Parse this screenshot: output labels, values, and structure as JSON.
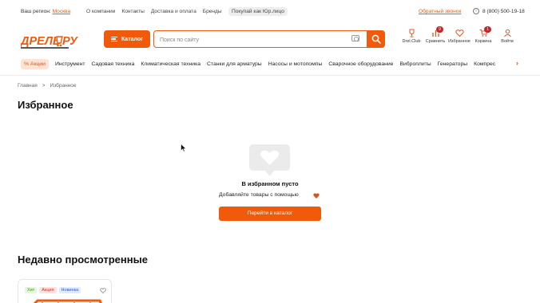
{
  "topbar": {
    "region_label": "Ваш регион:",
    "region_city": "Москва",
    "links": [
      "О компании",
      "Контакты",
      "Доставка и оплата",
      "Бренды"
    ],
    "legal_label": "Покупай как Юр.лицо",
    "callback_label": "Обратный звонок",
    "phone": "8 (800) 500-19-18"
  },
  "header": {
    "logo_text": "ДРЕЛЬ.РУ",
    "catalog_label": "Каталог",
    "search_placeholder": "Поиск по сайту",
    "icons": {
      "club": {
        "label": "Drel.Club"
      },
      "compare": {
        "label": "Сравнить",
        "badge": "9"
      },
      "favorites": {
        "label": "Избранное"
      },
      "cart": {
        "label": "Корзина",
        "badge": "1"
      },
      "login": {
        "label": "Войти"
      }
    }
  },
  "categories": {
    "sale_label": "% Акции",
    "items": [
      "Инструмент",
      "Садовая техника",
      "Климатическая техника",
      "Станки для арматуры",
      "Насосы и мотопомпы",
      "Сварочное оборудование",
      "Виброплиты",
      "Генераторы",
      "Компрес"
    ]
  },
  "breadcrumb": {
    "home": "Главная",
    "separator": ">",
    "current": "Избранное"
  },
  "page": {
    "title": "Избранное",
    "empty_title": "В избранном пусто",
    "empty_hint": "Добавляйте товары с помощью",
    "goto_catalog_label": "Перейти в каталог",
    "recent_title": "Недавно просмотренные"
  },
  "recent_card": {
    "tags": {
      "hit": "Хит",
      "sale": "Акция",
      "new": "Новинка"
    }
  },
  "colors": {
    "accent": "#f05a0a",
    "badge": "#c0262d",
    "heart": "#d9531e"
  }
}
